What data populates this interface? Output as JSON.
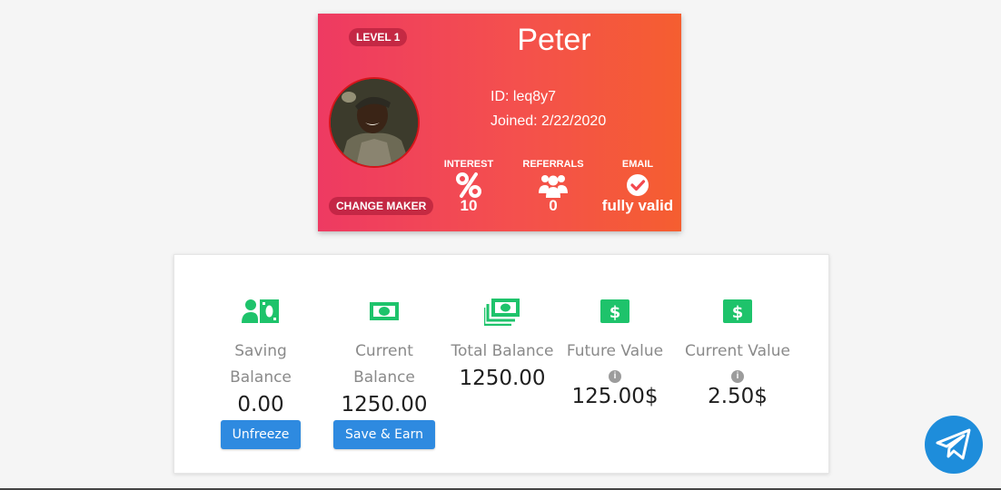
{
  "profile": {
    "level": "LEVEL 1",
    "name": "Peter",
    "id_line": "ID: leq8y7",
    "joined_line": "Joined: 2/22/2020",
    "rank": "CHANGE MAKER",
    "stats": [
      {
        "label": "INTEREST",
        "icon": "percent-icon",
        "value": "10"
      },
      {
        "label": "REFERRALS",
        "icon": "users-icon",
        "value": "0"
      },
      {
        "label": "EMAIL",
        "icon": "check-circle-icon",
        "value": "fully valid"
      }
    ],
    "gradient_start": "#ee3a62",
    "gradient_end": "#f55e30"
  },
  "balances": {
    "accent": "#1ec36b",
    "items": [
      {
        "label": "Saving Balance",
        "value": "0.00",
        "icon": "user-money-icon",
        "button": "Unfreeze"
      },
      {
        "label": "Current Balance",
        "value": "1250.00",
        "icon": "money-bill-icon",
        "button": "Save & Earn"
      },
      {
        "label": "Total Balance",
        "value": "1250.00",
        "icon": "money-bills-icon"
      },
      {
        "label": "Future Value",
        "value": "125.00$",
        "icon": "dollar-icon",
        "info": "i"
      },
      {
        "label": "Current Value",
        "value": "2.50$",
        "icon": "dollar-icon",
        "info": "i"
      }
    ],
    "button_color": "#2e8ae0"
  },
  "telegram": {
    "icon": "telegram-icon",
    "color": "#1e8ddb"
  }
}
